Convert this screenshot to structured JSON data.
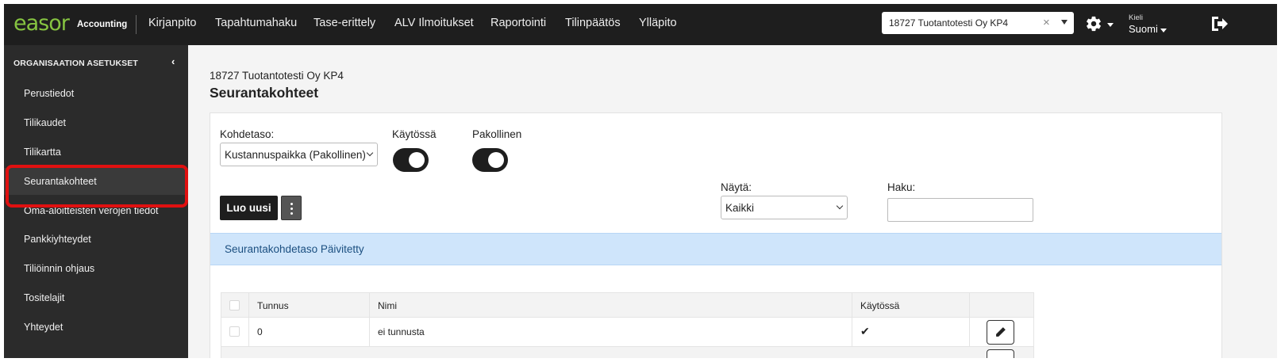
{
  "brand": {
    "logo": "easor",
    "product": "Accounting"
  },
  "nav": {
    "items": [
      "Kirjanpito",
      "Tapahtumahaku",
      "Tase-erittely",
      "ALV Ilmoitukset",
      "Raportointi",
      "Tilinpäätös",
      "Ylläpito"
    ]
  },
  "company_select": {
    "value": "18727 Tuotantotesti Oy KP4",
    "clear": "×"
  },
  "language": {
    "label": "Kieli",
    "value": "Suomi"
  },
  "sidebar": {
    "heading": "ORGANISAATION ASETUKSET",
    "collapse": "‹",
    "items": [
      {
        "label": "Perustiedot"
      },
      {
        "label": "Tilikaudet"
      },
      {
        "label": "Tilikartta"
      },
      {
        "label": "Seurantakohteet"
      },
      {
        "label": "Oma-aloitteisten verojen tiedot"
      },
      {
        "label": "Pankkiyhteydet"
      },
      {
        "label": "Tiliöinnin ohjaus"
      },
      {
        "label": "Tositelajit"
      },
      {
        "label": "Yhteydet"
      }
    ],
    "active_index": 3
  },
  "page": {
    "breadcrumb": "18727 Tuotantotesti Oy KP4",
    "title": "Seurantakohteet"
  },
  "filters": {
    "level_label": "Kohdetaso:",
    "level_value": "Kustannuspaikka (Pakollinen)",
    "enabled_label": "Käytössä",
    "enabled": true,
    "mandatory_label": "Pakollinen",
    "mandatory": true,
    "show_label": "Näytä:",
    "show_value": "Kaikki",
    "search_label": "Haku:",
    "search_value": ""
  },
  "actions": {
    "create_label": "Luo uusi"
  },
  "alert": {
    "text": "Seurantakohdetaso Päivitetty"
  },
  "table": {
    "columns": [
      "Tunnus",
      "Nimi",
      "Käytössä"
    ],
    "rows": [
      {
        "tunnus": "0",
        "nimi": "ei tunnusta",
        "kaytossa": "✔"
      }
    ]
  },
  "colors": {
    "brand_green": "#86c441",
    "topbar": "#1e1e1e",
    "sidebar": "#2b2b2b",
    "alert_bg": "#cfe5fb",
    "highlight": "#e01010"
  }
}
